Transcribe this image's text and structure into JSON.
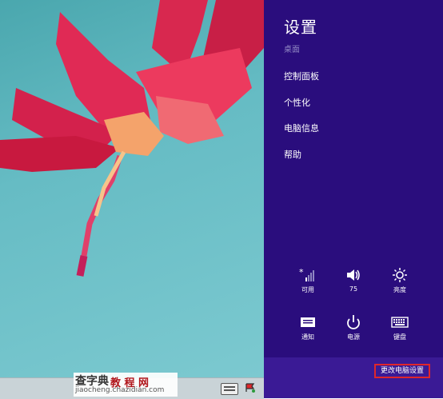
{
  "charm": {
    "title": "设置",
    "context": "桌面",
    "menu": [
      "控制面板",
      "个性化",
      "电脑信息",
      "帮助"
    ],
    "quick_row1": [
      {
        "icon": "wifi-icon",
        "label": "可用"
      },
      {
        "icon": "volume-icon",
        "label": "75"
      },
      {
        "icon": "brightness-icon",
        "label": "亮度"
      }
    ],
    "quick_row2": [
      {
        "icon": "notification-icon",
        "label": "通知"
      },
      {
        "icon": "power-icon",
        "label": "电源"
      },
      {
        "icon": "keyboard-icon",
        "label": "键盘"
      }
    ],
    "change_pc_settings": "更改电脑设置",
    "background_color": "#2a0d7d",
    "highlight_color": "#e0262b"
  },
  "watermark": {
    "brand": "查字典",
    "middle": "教 程 网",
    "url": "jiaocheng.chazidian.com"
  }
}
